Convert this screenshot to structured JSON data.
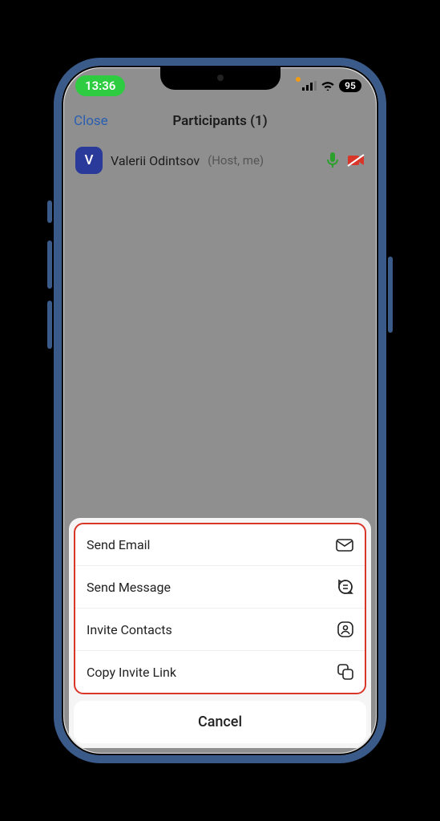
{
  "statusbar": {
    "time": "13:36",
    "battery": "95"
  },
  "nav": {
    "close": "Close",
    "title": "Participants (1)"
  },
  "participant": {
    "initial": "V",
    "name": "Valerii Odintsov",
    "role": "(Host, me)"
  },
  "sheet": {
    "items": [
      {
        "label": "Send Email"
      },
      {
        "label": "Send Message"
      },
      {
        "label": "Invite Contacts"
      },
      {
        "label": "Copy Invite Link"
      }
    ],
    "cancel": "Cancel"
  }
}
